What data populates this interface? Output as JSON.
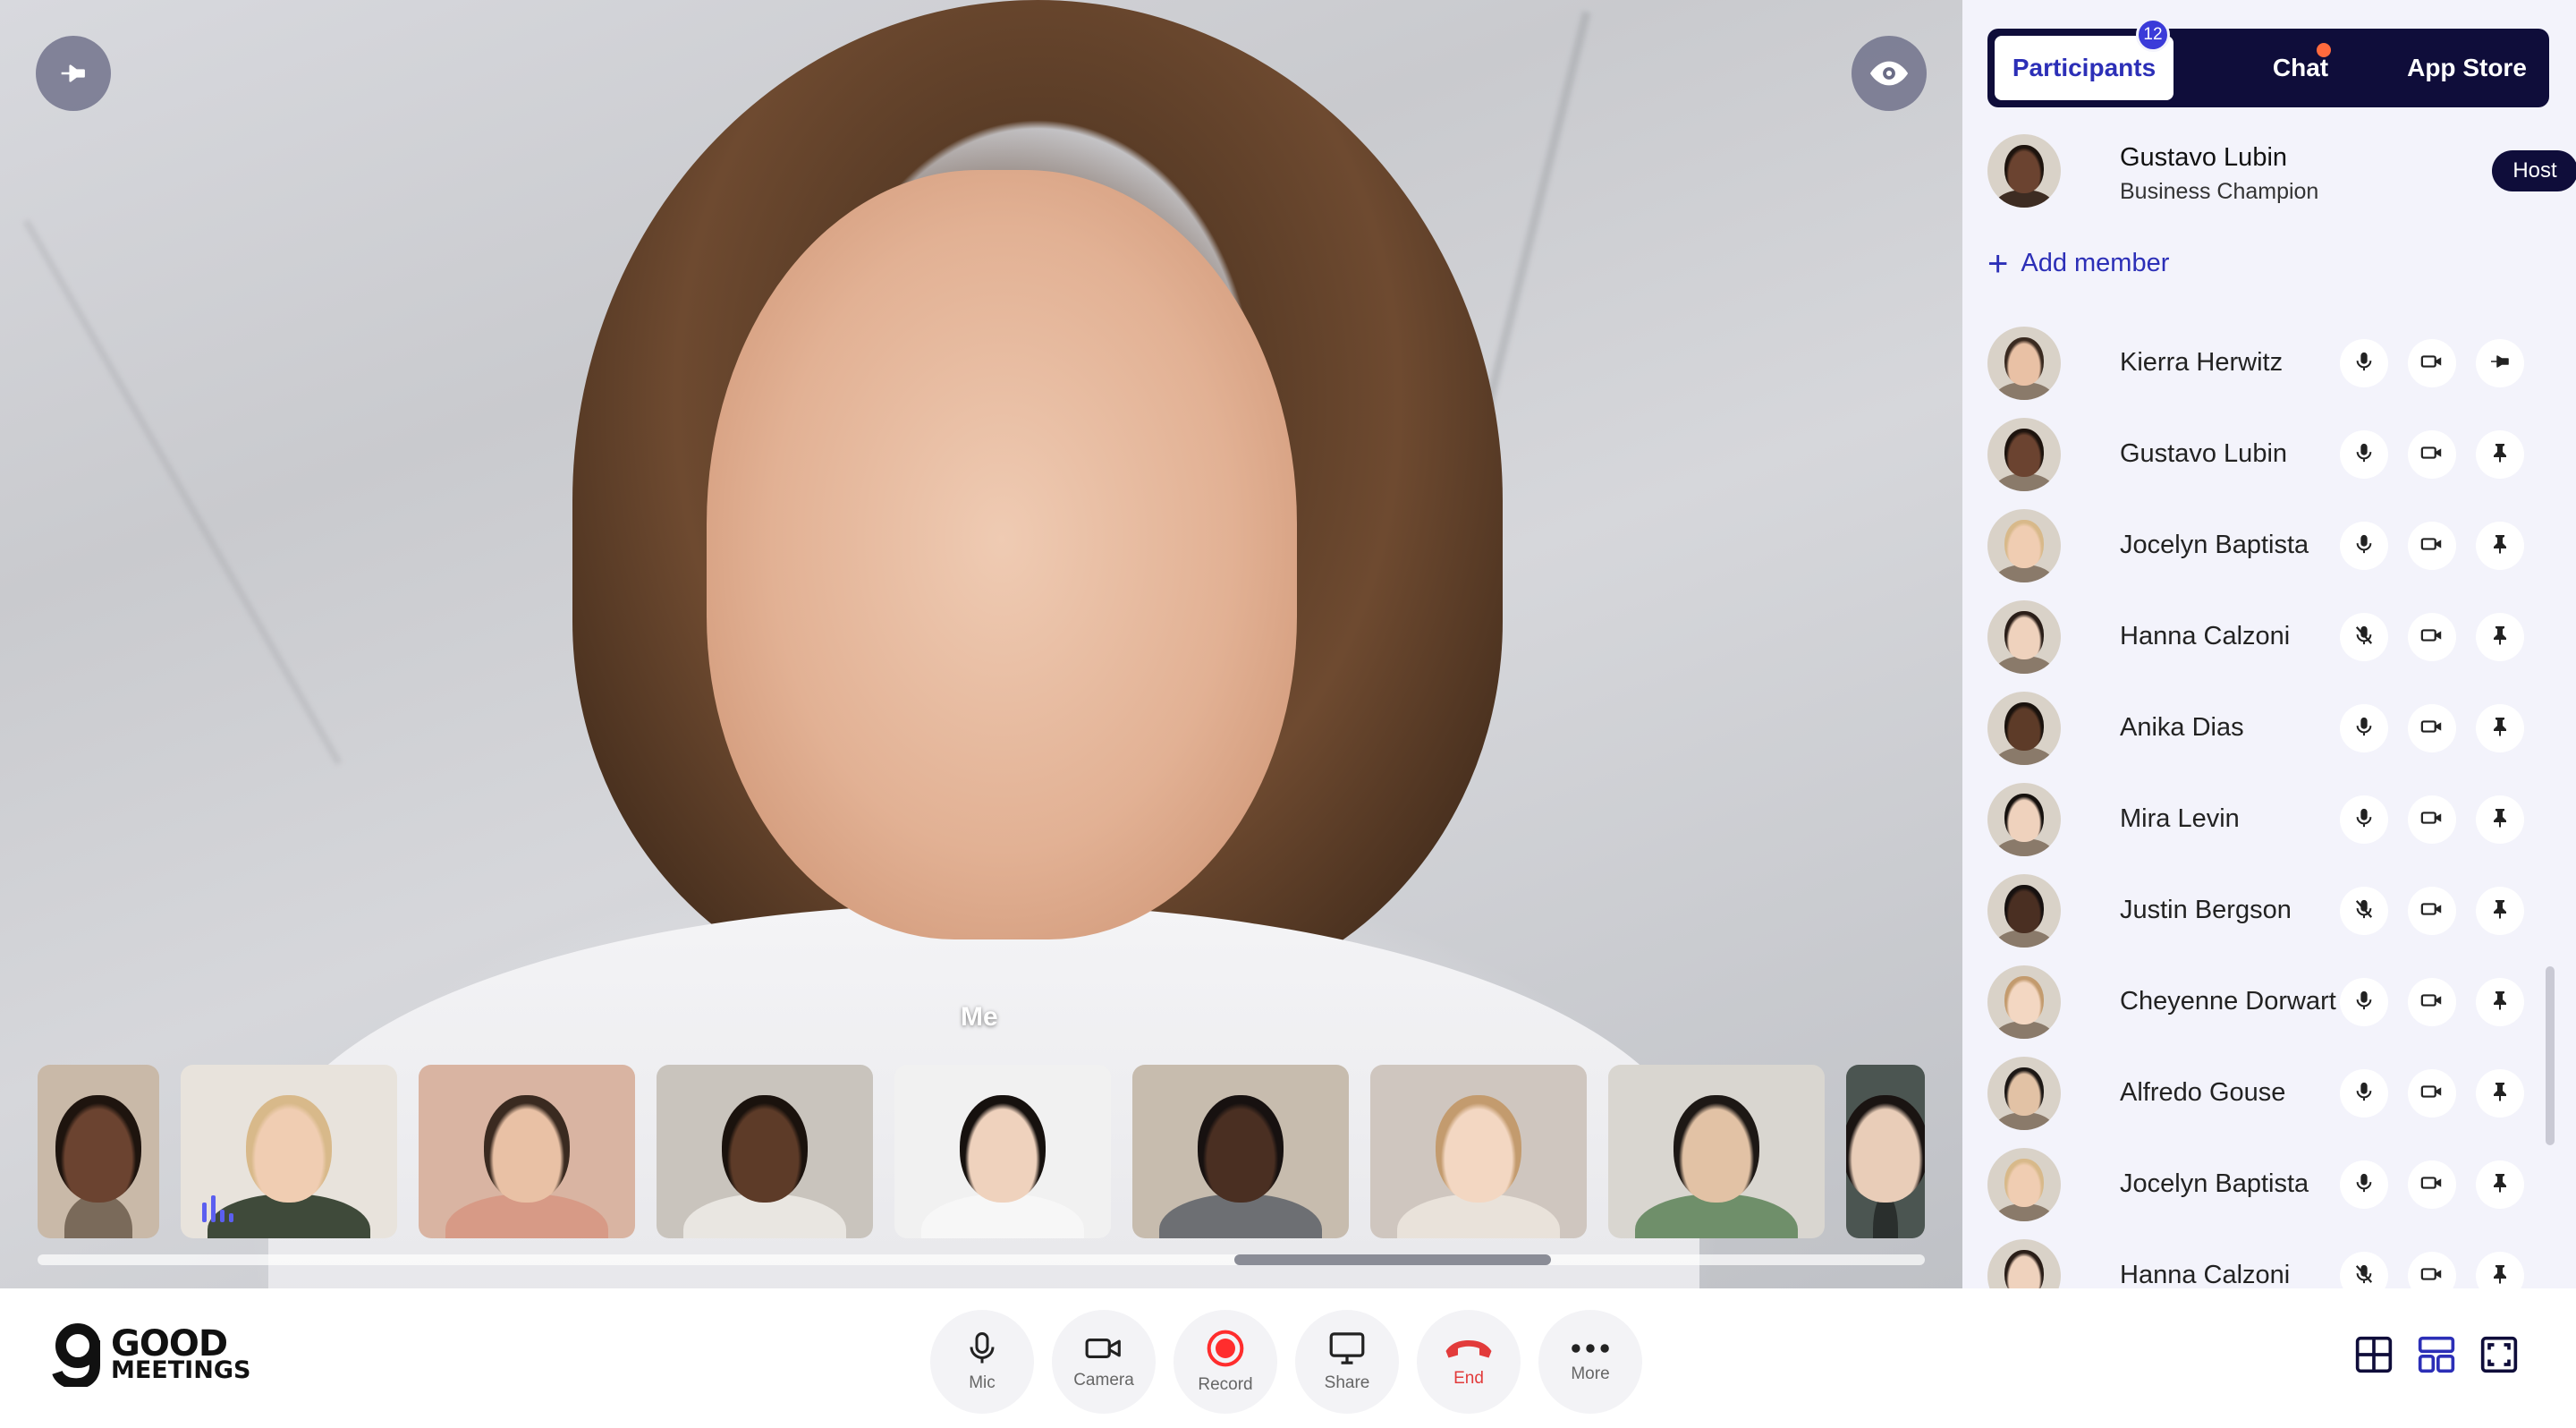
{
  "stage": {
    "me_label": "Me",
    "pin_icon": "pin-icon",
    "visibility_icon": "eye-icon"
  },
  "thumbnails": [
    {
      "skin": "#6b4330",
      "hair": "#1e140e",
      "bg": "#c9b9a8",
      "shirt": "#7a6a5a"
    },
    {
      "skin": "#f0cdb2",
      "hair": "#d8b98a",
      "bg": "#e8e3dc",
      "shirt": "#3f4a3a",
      "speaking": true
    },
    {
      "skin": "#e9c1a5",
      "hair": "#3a2a20",
      "bg": "#d9b4a2",
      "shirt": "#d79a86"
    },
    {
      "skin": "#5d3b28",
      "hair": "#1a120d",
      "bg": "#c9c4bd",
      "shirt": "#e9e6e1"
    },
    {
      "skin": "#efd2bd",
      "hair": "#16110e",
      "bg": "#f1f1f1",
      "shirt": "#f7f7f7"
    },
    {
      "skin": "#4a2f22",
      "hair": "#171110",
      "bg": "#c7bcae",
      "shirt": "#6d6f73"
    },
    {
      "skin": "#f3d7c2",
      "hair": "#c39b6e",
      "bg": "#cfc6bf",
      "shirt": "#e9e2da"
    },
    {
      "skin": "#e2c2a5",
      "hair": "#1d1815",
      "bg": "#d9d6d0",
      "shirt": "#6f8f6a"
    },
    {
      "skin": "#e9cdb8",
      "hair": "#1a1412",
      "bg": "#4b5551",
      "shirt": "#2a2f2d"
    }
  ],
  "sidebar": {
    "tabs": [
      {
        "label": "Participants",
        "active": true
      },
      {
        "label": "Chat",
        "active": false
      },
      {
        "label": "App Store",
        "active": false
      }
    ],
    "participant_count": "12",
    "host": {
      "name": "Gustavo Lubin",
      "role": "Business Champion",
      "badge": "Host",
      "skin": "#6b4330",
      "hair": "#1e140e"
    },
    "add_member_label": "Add member",
    "participants": [
      {
        "name": "Kierra Herwitz",
        "mic": "on",
        "pin": "unpin",
        "skin": "#e9c1a5",
        "hair": "#3a2a20"
      },
      {
        "name": "Gustavo Lubin",
        "mic": "on",
        "pin": "pin",
        "skin": "#6b4330",
        "hair": "#1e140e"
      },
      {
        "name": "Jocelyn Baptista",
        "mic": "on",
        "pin": "pin",
        "skin": "#f0cdb2",
        "hair": "#d8b98a"
      },
      {
        "name": "Hanna Calzoni",
        "mic": "off",
        "pin": "pin",
        "skin": "#efd2bd",
        "hair": "#2a1e18"
      },
      {
        "name": "Anika Dias",
        "mic": "on",
        "pin": "pin",
        "skin": "#5d3b28",
        "hair": "#1a120d"
      },
      {
        "name": "Mira Levin",
        "mic": "on",
        "pin": "pin",
        "skin": "#efd2bd",
        "hair": "#16110e"
      },
      {
        "name": "Justin Bergson",
        "mic": "off",
        "pin": "pin",
        "skin": "#4a2f22",
        "hair": "#171110"
      },
      {
        "name": "Cheyenne Dorwart",
        "mic": "on",
        "pin": "pin",
        "skin": "#f3d7c2",
        "hair": "#c39b6e"
      },
      {
        "name": "Alfredo Gouse",
        "mic": "on",
        "pin": "pin",
        "skin": "#e2c2a5",
        "hair": "#1d1815"
      },
      {
        "name": "Jocelyn Baptista",
        "mic": "on",
        "pin": "pin",
        "skin": "#f0cdb2",
        "hair": "#d8b98a"
      },
      {
        "name": "Hanna Calzoni",
        "mic": "off",
        "pin": "pin",
        "skin": "#efd2bd",
        "hair": "#2a1e18"
      }
    ]
  },
  "toolbar": {
    "logo_line1": "GOOD",
    "logo_line2": "MEETINGS",
    "buttons": [
      {
        "label": "Mic",
        "icon": "microphone-icon"
      },
      {
        "label": "Camera",
        "icon": "camera-icon"
      },
      {
        "label": "Record",
        "icon": "record-icon"
      },
      {
        "label": "Share",
        "icon": "monitor-icon"
      },
      {
        "label": "End",
        "icon": "phone-hangup-icon"
      },
      {
        "label": "More",
        "icon": "more-dots-icon"
      }
    ],
    "view_icons": [
      "grid-view-icon",
      "layout-view-icon",
      "fullscreen-view-icon"
    ]
  },
  "colors": {
    "accent": "#2c2fb7",
    "dark_navy": "#0f0d3a",
    "end_red": "#e23b3b",
    "record_red": "#ff2d2d",
    "notification": "#ff6a3d",
    "sidebar_bg": "#f3f3fb"
  }
}
